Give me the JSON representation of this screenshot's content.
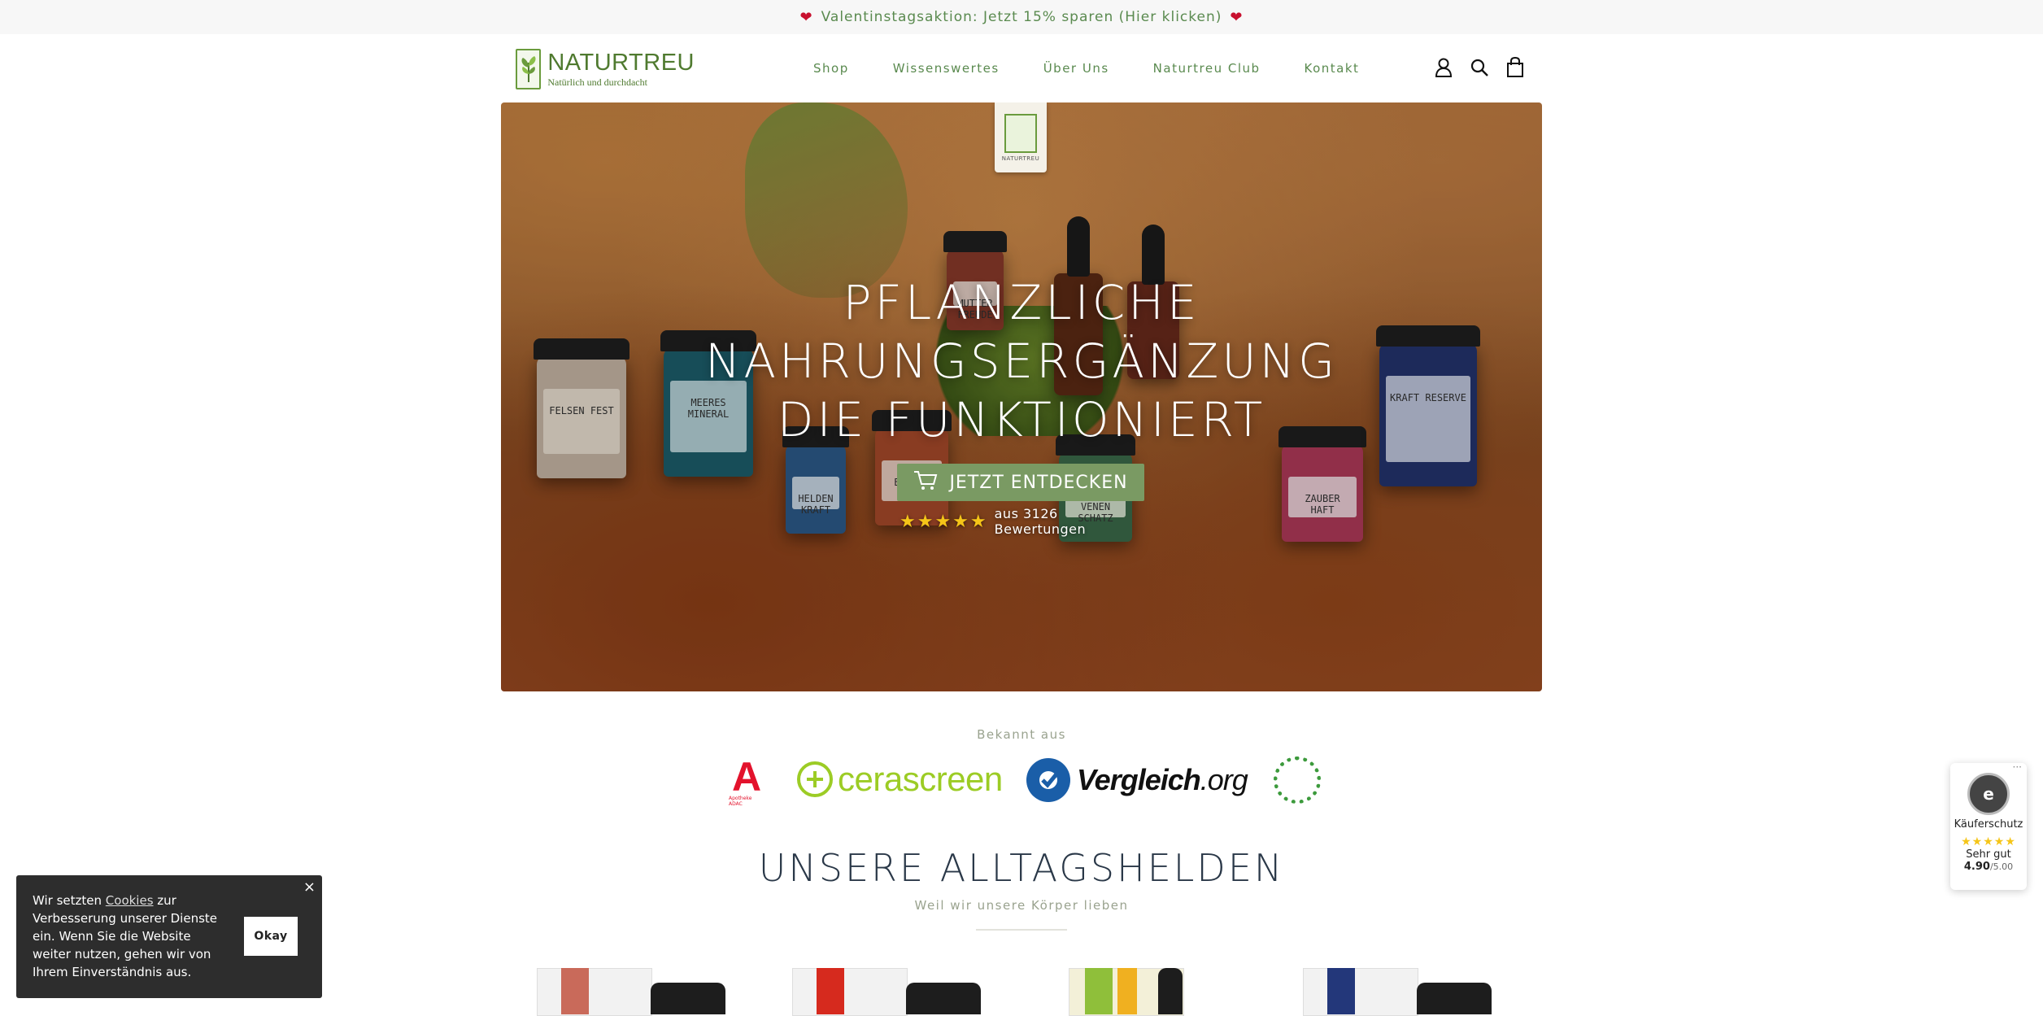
{
  "announcement": {
    "text": "Valentinstagsaktion: Jetzt 15% sparen (Hier klicken)",
    "icon": "heart-icon"
  },
  "header": {
    "logo": {
      "name": "NATURTREU",
      "tagline": "Natürlich und durchdacht"
    },
    "nav": [
      "Shop",
      "Wissenswertes",
      "Über Uns",
      "Naturtreu Club",
      "Kontakt"
    ],
    "icons": [
      "account-icon",
      "search-icon",
      "cart-icon"
    ]
  },
  "hero": {
    "badge_text": "NATURTREU",
    "headline": [
      "Pflanzliche",
      "Nahrungsergänzung",
      "die funktioniert"
    ],
    "cta_label": "JETZT ENTDECKEN",
    "rating_stars": "★★★★★",
    "rating_text": "aus 3126 Bewertungen",
    "product_labels": [
      "FELSEN FEST",
      "MEERES MINERAL",
      "HELDEN KRAFT",
      "BLÜTEN",
      "MUTTER FREUDE",
      "VENEN SCHATZ",
      "ZAUBER HAFT",
      "KRAFT RESERVE"
    ]
  },
  "known_from": {
    "title": "Bekannt aus",
    "apotheke_letter": "A",
    "apotheke_sub": "Apotheke ADAC",
    "cerascreen": "cerascreen",
    "vergleich_bold": "Vergleich",
    "vergleich_rest": ".org"
  },
  "section": {
    "title": "Unsere Alltagshelden",
    "subtitle": "Weil wir unsere Körper lieben"
  },
  "cookie": {
    "text_before": "Wir setzten ",
    "link": "Cookies",
    "text_after": " zur Verbesserung unserer Dienste ein. Wenn Sie die Website weiter nutzen, gehen wir von Ihrem Einverständnis aus.",
    "ok_label": "Okay",
    "close": "×"
  },
  "trust_widget": {
    "more": "···",
    "label": "Käuferschutz",
    "stars": "★★★★★",
    "rating_word": "Sehr gut",
    "score": "4.90",
    "max": "/5.00"
  },
  "colors": {
    "brand_green": "#5a8a4f",
    "cta_green": "#7a9a63",
    "heart_red": "#c8102e",
    "star_gold": "#f5c518"
  }
}
